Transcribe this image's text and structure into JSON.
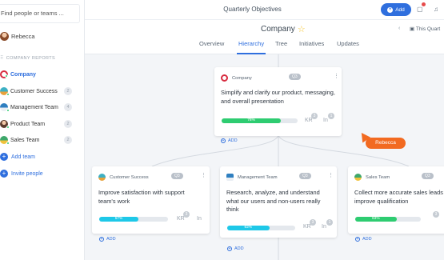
{
  "sidebar": {
    "search_placeholder": "Find people or teams ...",
    "user_name": "Rebecca",
    "section_label": "COMPANY REPORTS",
    "items": [
      {
        "label": "Company",
        "count": ""
      },
      {
        "label": "Customer Success",
        "count": "2"
      },
      {
        "label": "Management Team",
        "count": "4"
      },
      {
        "label": "Product Team",
        "count": "2"
      },
      {
        "label": "Sales Team",
        "count": "2"
      }
    ],
    "add_team_label": "Add team",
    "invite_label": "Invite people"
  },
  "header": {
    "title": "Quarterly Objectives",
    "add_label": "Add",
    "period_label": "This Quart"
  },
  "page": {
    "company_title": "Company",
    "tabs": [
      "Overview",
      "Hierarchy",
      "Tree",
      "Initiatives",
      "Updates"
    ],
    "active_tab": "Hierarchy"
  },
  "cards": {
    "root": {
      "team": "Company",
      "quarter": "Q3",
      "objective": "Simplify and clarify our product, messaging, and overall presentation",
      "progress": "78%",
      "progress_value": 78,
      "kr_count": "3",
      "in_count": "1",
      "color": "#2ecc71",
      "add_label": "ADD"
    },
    "customer_success": {
      "team": "Customer Success",
      "quarter": "Q3",
      "objective": "Improve satisfaction with support team's work",
      "progress": "57%",
      "progress_value": 57,
      "kr_count": "3",
      "in_count": "",
      "color": "#1ec8e8",
      "add_label": "ADD"
    },
    "management": {
      "team": "Management Team",
      "quarter": "Q3",
      "objective": "Research, analyze, and understand what our users and non-users really think",
      "progress": "62%",
      "progress_value": 62,
      "kr_count": "3",
      "in_count": "1",
      "color": "#1ec8e8",
      "add_label": "ADD"
    },
    "sales": {
      "team": "Sales Team",
      "quarter": "Q3",
      "objective": "Collect more accurate sales leads to improve qualification",
      "progress": "63%",
      "progress_value": 63,
      "kr_count": "3",
      "in_count": "",
      "color": "#2ecc71",
      "add_label": "ADD"
    }
  },
  "labels": {
    "kr": "KR",
    "in": "In"
  },
  "cursor_user": "Rebecca"
}
